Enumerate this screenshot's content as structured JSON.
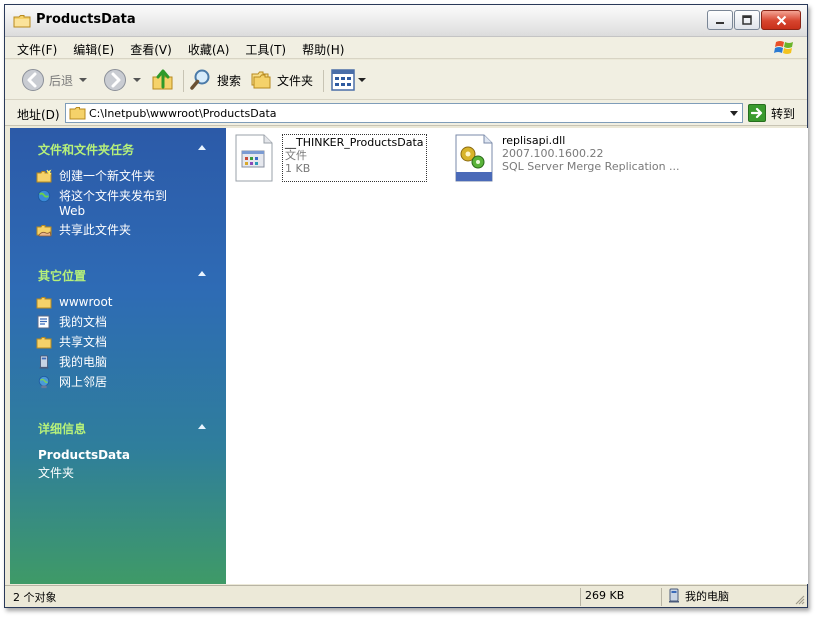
{
  "window": {
    "title": "ProductsData"
  },
  "menu": [
    {
      "label": "文件(F)"
    },
    {
      "label": "编辑(E)"
    },
    {
      "label": "查看(V)"
    },
    {
      "label": "收藏(A)"
    },
    {
      "label": "工具(T)"
    },
    {
      "label": "帮助(H)"
    }
  ],
  "toolbar": {
    "back_label": "后退",
    "search_label": "搜索",
    "folders_label": "文件夹"
  },
  "address": {
    "label": "地址(D)",
    "path": "C:\\Inetpub\\wwwroot\\ProductsData",
    "go_label": "转到"
  },
  "sidebar": {
    "tasks": {
      "title": "文件和文件夹任务",
      "items": [
        {
          "label": "创建一个新文件夹",
          "icon": "new-folder-icon"
        },
        {
          "label": "将这个文件夹发布到 Web",
          "icon": "publish-web-icon"
        },
        {
          "label": "共享此文件夹",
          "icon": "share-folder-icon"
        }
      ]
    },
    "places": {
      "title": "其它位置",
      "items": [
        {
          "label": "wwwroot",
          "icon": "folder-icon"
        },
        {
          "label": "我的文档",
          "icon": "my-documents-icon"
        },
        {
          "label": "共享文档",
          "icon": "shared-documents-icon"
        },
        {
          "label": "我的电脑",
          "icon": "my-computer-icon"
        },
        {
          "label": "网上邻居",
          "icon": "network-places-icon"
        }
      ]
    },
    "details": {
      "title": "详细信息",
      "name": "ProductsData",
      "type": "文件夹"
    }
  },
  "files": [
    {
      "name": "__THINKER_ProductsData",
      "line2": "文件",
      "line3": "1 KB"
    },
    {
      "name": "replisapi.dll",
      "line2": "2007.100.1600.22",
      "line3": "SQL Server Merge Replication ..."
    }
  ],
  "status": {
    "objects": "2 个对象",
    "size": "269 KB",
    "zone": "我的电脑"
  },
  "colors": {
    "sidebar_top": "#2c5aa8",
    "sidebar_bottom": "#3f9a67",
    "sidebar_heading": "#b6f07a",
    "close_button": "#d7442e"
  }
}
